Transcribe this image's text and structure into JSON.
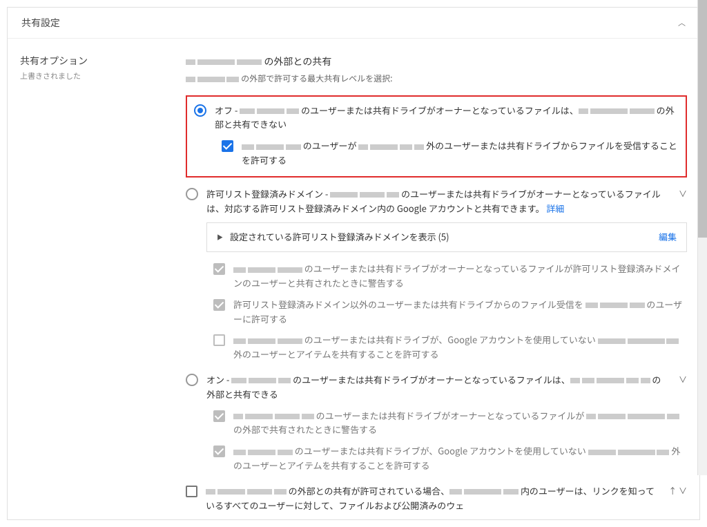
{
  "panel": {
    "title": "共有設定"
  },
  "left": {
    "heading": "共有オプション",
    "sub": "上書きされました"
  },
  "main": {
    "title_prefix": "",
    "title_suffix": " の外部との共有",
    "sub_prefix": "",
    "sub_suffix": " の外部で許可する最大共有レベルを選択:",
    "opt_off_line1_a": "オフ - ",
    "opt_off_line1_b": " のユーザーまたは共有ドライブがオーナーとなっているファイルは、",
    "opt_off_line2": " の外部と共有できない",
    "chk1_a": " のユーザーが ",
    "chk1_b": " 外のユーザーまたは共有ドライブからファイルを受信することを許可する",
    "opt_allow_a": "許可リスト登録済みドメイン - ",
    "opt_allow_b": " のユーザーまたは共有ドライブがオーナーとなっているファイルは、対応する許可リスト登録済みドメイン内の Google アカウントと共有できます。",
    "detail_link": "詳細",
    "expander_label": "設定されている許可リスト登録済みドメインを表示 (5)",
    "expander_action": "編集",
    "sc1_a": " のユーザーまたは共有ドライブがオーナーとなっているファイルが許可リスト登録済みドメインのユーザーと共有されたときに警告する",
    "sc2_a": "許可リスト登録済みドメイン以外のユーザーまたは共有ドライブからのファイル受信を ",
    "sc2_b": " のユーザーに許可する",
    "sc3_a": " のユーザーまたは共有ドライブが、Google アカウントを使用していない ",
    "sc3_b": " 外のユーザーとアイテムを共有することを許可する",
    "opt_on_a": "オン - ",
    "opt_on_b": " のユーザーまたは共有ドライブがオーナーとなっているファイルは、",
    "opt_on_c": " の外部と共有できる",
    "sc4_a": " のユーザーまたは共有ドライブがオーナーとなっているファイルが ",
    "sc4_b": " の外部で共有されたときに警告する",
    "sc5_a": " のユーザーまたは共有ドライブが、Google アカウントを使用していない ",
    "sc5_b": " 外のユーザーとアイテムを共有することを許可する",
    "bottom_a": " の外部との共有が許可されている場合、",
    "bottom_b": " 内のユーザーは、リンクを知っているすべてのユーザーに対して、ファイルおよび公開済みのウェ"
  }
}
